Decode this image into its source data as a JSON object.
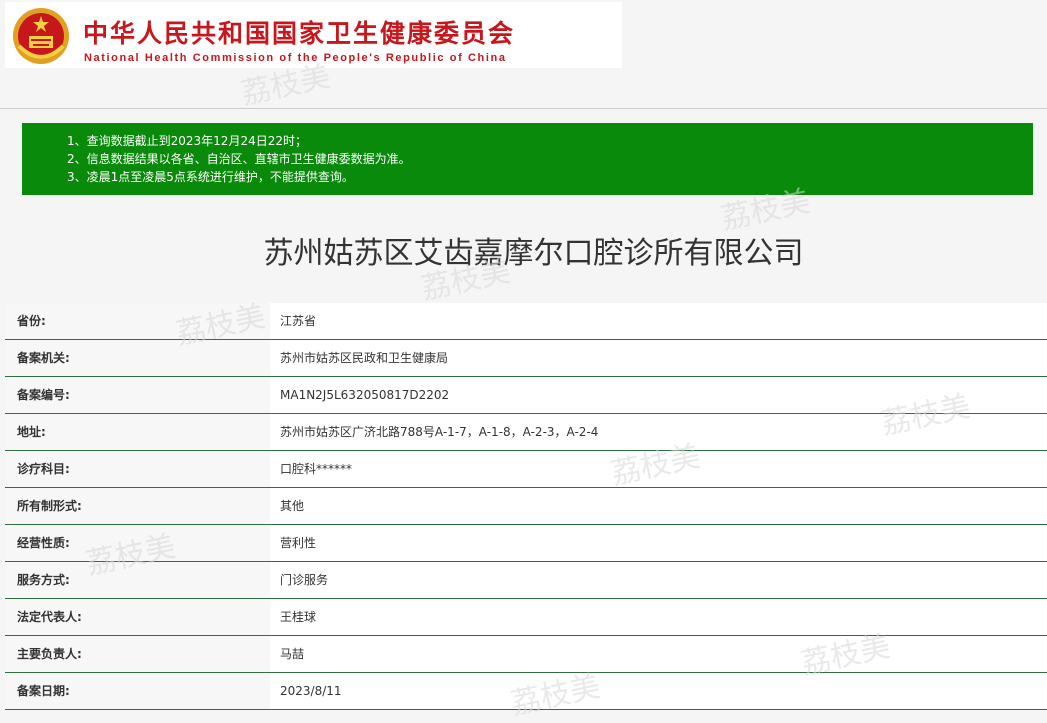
{
  "header": {
    "cn_title": "中华人民共和国国家卫生健康委员会",
    "en_title": "National Health Commission of the People's Republic of China",
    "emblem_icon": "national-emblem-icon"
  },
  "notice": {
    "lines": [
      "1、查询数据截止到2023年12月24日22时；",
      "2、信息数据结果以各省、自治区、直辖市卫生健康委数据为准。",
      "3、凌晨1点至凌晨5点系统进行维护，不能提供查询。"
    ],
    "bg_color": "#0a8a0a"
  },
  "company_name": "苏州姑苏区艾齿嘉摩尔口腔诊所有限公司",
  "details": [
    {
      "label": "省份:",
      "value": "江苏省"
    },
    {
      "label": "备案机关:",
      "value": "苏州市姑苏区民政和卫生健康局"
    },
    {
      "label": "备案编号:",
      "value": "MA1N2J5L632050817D2202"
    },
    {
      "label": "地址:",
      "value": "苏州市姑苏区广济北路788号A-1-7，A-1-8，A-2-3，A-2-4"
    },
    {
      "label": "诊疗科目:",
      "value": "口腔科******"
    },
    {
      "label": "所有制形式:",
      "value": "其他"
    },
    {
      "label": "经营性质:",
      "value": "营利性"
    },
    {
      "label": "服务方式:",
      "value": "门诊服务"
    },
    {
      "label": "法定代表人:",
      "value": "王桂球"
    },
    {
      "label": "主要负责人:",
      "value": "马喆"
    },
    {
      "label": "备案日期:",
      "value": "2023/8/11"
    }
  ],
  "watermark": "荔枝美",
  "accent_color": "#c8161d"
}
